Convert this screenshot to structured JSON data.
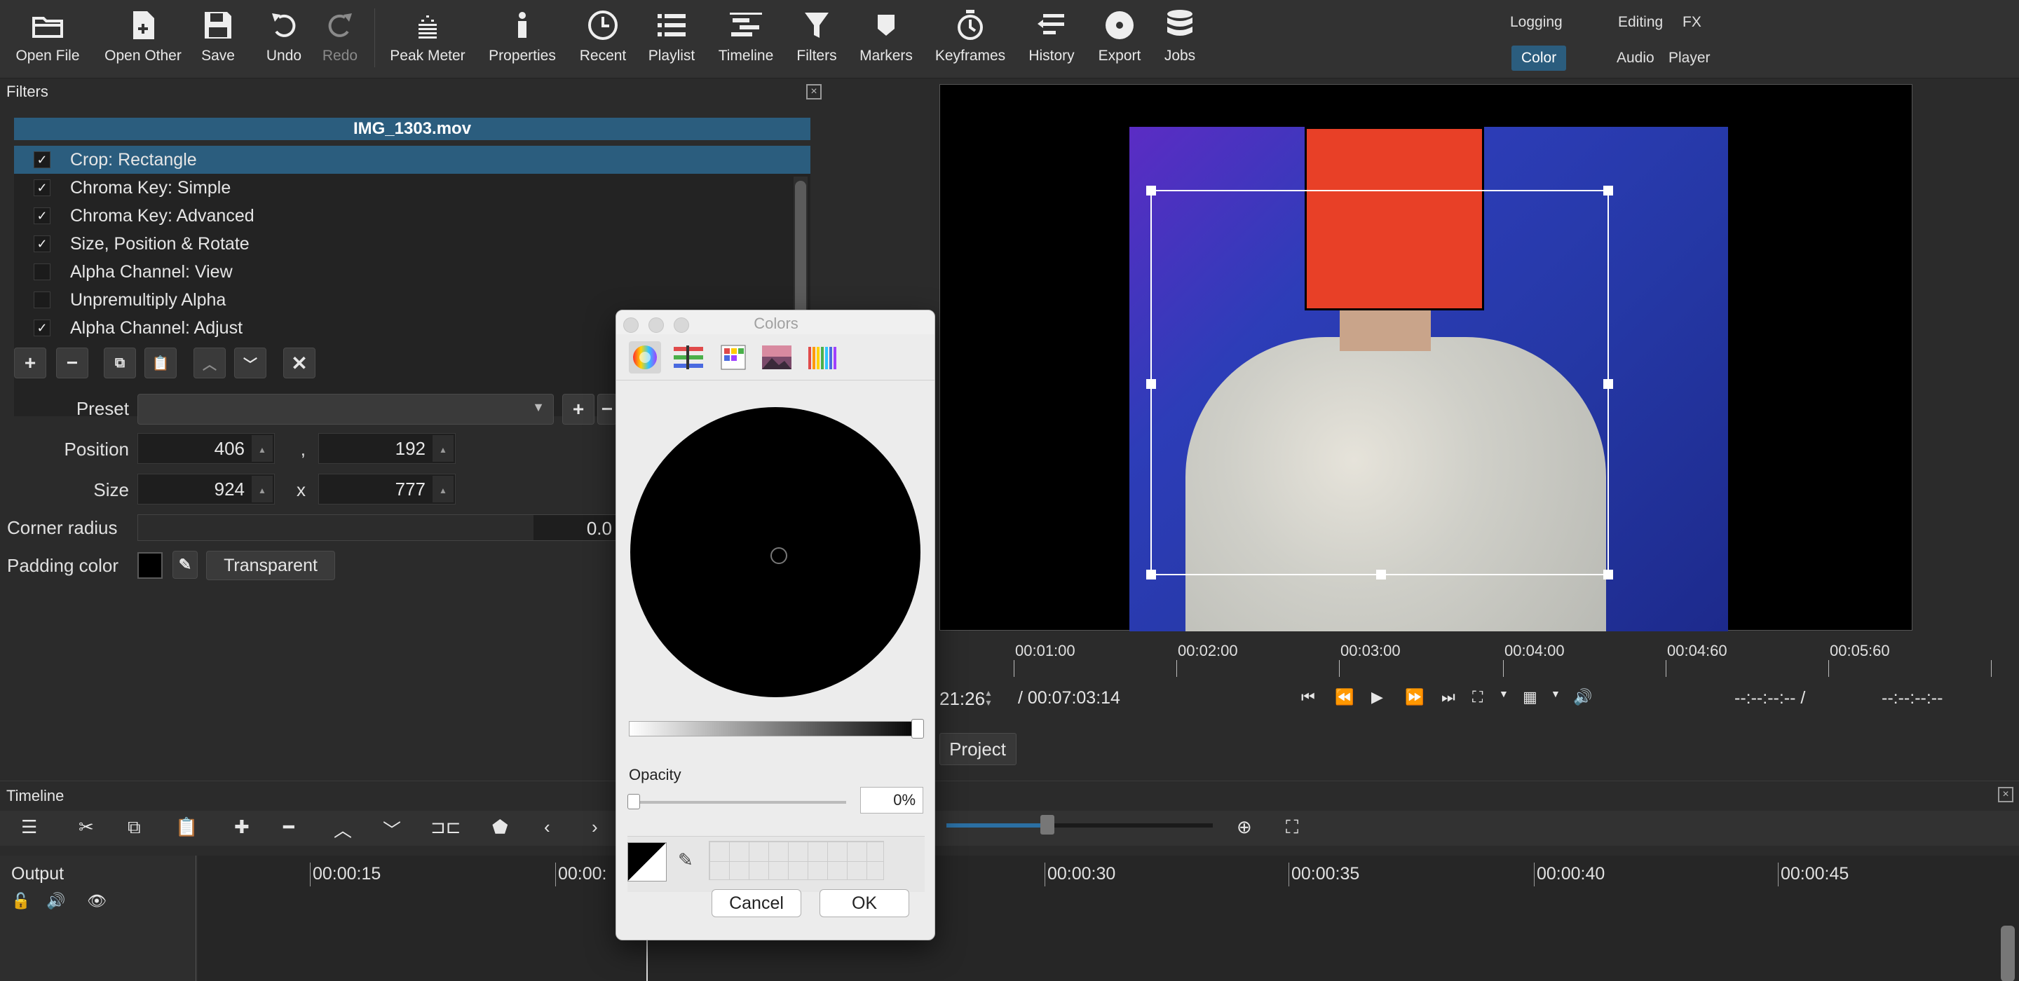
{
  "toolbar": {
    "open_file": "Open File",
    "open_other": "Open Other",
    "save": "Save",
    "undo": "Undo",
    "redo": "Redo",
    "peak_meter": "Peak Meter",
    "properties": "Properties",
    "recent": "Recent",
    "playlist": "Playlist",
    "timeline": "Timeline",
    "filters": "Filters",
    "markers": "Markers",
    "keyframes": "Keyframes",
    "history": "History",
    "export": "Export",
    "jobs": "Jobs"
  },
  "layouts": {
    "logging": "Logging",
    "editing": "Editing",
    "fx": "FX",
    "color": "Color",
    "audio": "Audio",
    "player": "Player"
  },
  "filters_panel": {
    "title": "Filters",
    "clip_name": "IMG_1303.mov",
    "items": [
      {
        "label": "Crop: Rectangle",
        "checked": true
      },
      {
        "label": "Chroma Key: Simple",
        "checked": true
      },
      {
        "label": "Chroma Key: Advanced",
        "checked": true
      },
      {
        "label": "Size, Position & Rotate",
        "checked": true
      },
      {
        "label": "Alpha Channel: View",
        "checked": false
      },
      {
        "label": "Unpremultiply Alpha",
        "checked": false
      },
      {
        "label": "Alpha Channel: Adjust",
        "checked": true
      }
    ],
    "check_mark": "✓",
    "preset_label": "Preset",
    "position_label": "Position",
    "position_x": "406",
    "position_sep": ",",
    "position_y": "192",
    "size_label": "Size",
    "size_w": "924",
    "size_sep": "x",
    "size_h": "777",
    "corner_radius_label": "Corner radius",
    "corner_radius_value": "0.0",
    "padding_color_label": "Padding color",
    "transparent_button": "Transparent"
  },
  "player": {
    "ruler_labels": [
      "00:01:00",
      "00:02:00",
      "00:03:00",
      "00:04:00",
      "00:04:60",
      "00:05:60"
    ],
    "current_time_partial": "21:26",
    "total_duration": "/ 00:07:03:14",
    "in_point": "--:--:--:-- /",
    "out_point": "--:--:--:--",
    "project_tab": "Project"
  },
  "timeline": {
    "title": "Timeline",
    "track_name": "Output",
    "ruler_labels": [
      "00:00:15",
      "00:00:",
      "00:00:30",
      "00:00:35",
      "00:00:40",
      "00:00:45"
    ]
  },
  "colors_dialog": {
    "title": "Colors",
    "opacity_label": "Opacity",
    "opacity_value": "0%",
    "cancel": "Cancel",
    "ok": "OK",
    "current_color": "#000000"
  }
}
